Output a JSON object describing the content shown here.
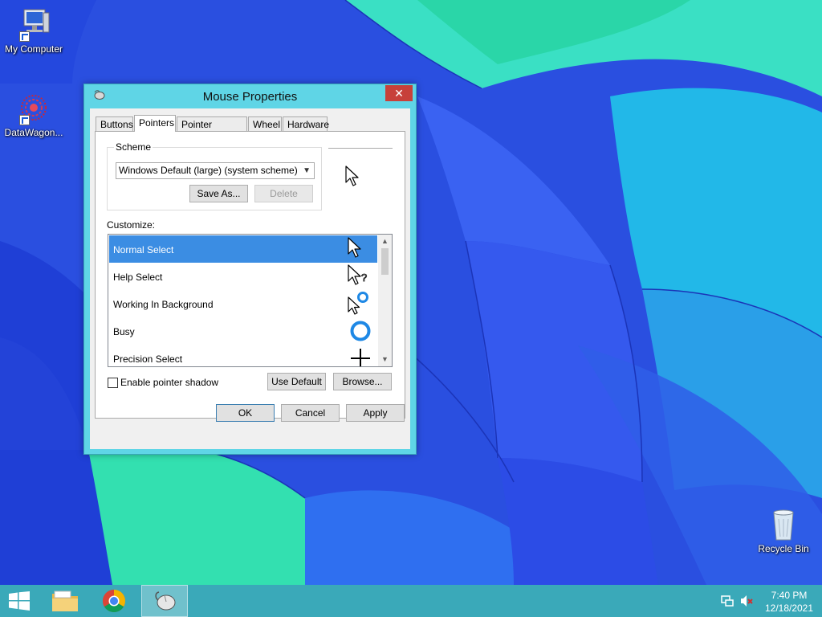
{
  "desktop": {
    "icons": [
      {
        "label": "My Computer"
      },
      {
        "label": "DataWagon..."
      },
      {
        "label": "Recycle Bin"
      }
    ]
  },
  "dialog": {
    "title": "Mouse Properties",
    "close_glyph": "✕",
    "tabs": [
      "Buttons",
      "Pointers",
      "Pointer Options",
      "Wheel",
      "Hardware"
    ],
    "active_tab": "Pointers",
    "scheme": {
      "group_label": "Scheme",
      "selected": "Windows Default (large) (system scheme)",
      "save_as_label": "Save As...",
      "delete_label": "Delete"
    },
    "customize": {
      "label": "Customize:",
      "items": [
        {
          "label": "Normal Select",
          "icon": "arrow-pointer-icon",
          "selected": true
        },
        {
          "label": "Help Select",
          "icon": "help-pointer-icon",
          "selected": false
        },
        {
          "label": "Working In Background",
          "icon": "working-pointer-icon",
          "selected": false
        },
        {
          "label": "Busy",
          "icon": "busy-ring-icon",
          "selected": false
        },
        {
          "label": "Precision Select",
          "icon": "crosshair-icon",
          "selected": false
        }
      ]
    },
    "shadow_checkbox": {
      "label": "Enable pointer shadow",
      "checked": false
    },
    "use_default_label": "Use Default",
    "browse_label": "Browse...",
    "ok_label": "OK",
    "cancel_label": "Cancel",
    "apply_label": "Apply"
  },
  "taskbar": {
    "time": "7:40 PM",
    "date": "12/18/2021",
    "pinned": [
      "start-icon",
      "file-explorer-icon",
      "chrome-icon",
      "mouse-icon"
    ]
  },
  "colors": {
    "dialog_frame": "#5fd5e6",
    "close_button": "#c7403a",
    "selection": "#3b8de3",
    "taskbar": "#3aa9b9",
    "busy_ring": "#1e88e5"
  }
}
